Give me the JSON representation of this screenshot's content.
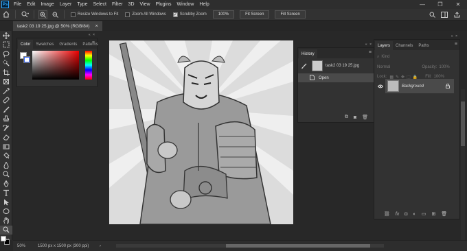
{
  "app": {
    "logo_text": "Ps"
  },
  "menu": [
    "File",
    "Edit",
    "Image",
    "Layer",
    "Type",
    "Select",
    "Filter",
    "3D",
    "View",
    "Plugins",
    "Window",
    "Help"
  ],
  "window_controls": {
    "minimize": "—",
    "restore": "❐",
    "close": "✕"
  },
  "options_bar": {
    "resize_windows_label": "Resize Windows to Fit",
    "zoom_all_label": "Zoom All Windows",
    "scrubby_zoom_label": "Scrubby Zoom",
    "scrubby_zoom_checked": true,
    "zoom_value": "100%",
    "fit_screen_label": "Fit Screen",
    "fill_screen_label": "Fill Screen"
  },
  "document_tab": {
    "title": "task2 03 19 25.jpg @ 50% (RGB/8#)",
    "close": "×"
  },
  "status": {
    "zoom": "50%",
    "doc_size": "1500 px x 1500 px (300 ppi)",
    "arrow": "›"
  },
  "color_panel": {
    "tabs": [
      "Color",
      "Swatches",
      "Gradients",
      "Patterns"
    ],
    "active_tab": "Color",
    "menu": "≡",
    "collapse": "«  ×"
  },
  "history_panel": {
    "tab": "History",
    "snapshot_name": "task2 03 19 25.jpg",
    "steps": [
      "Open"
    ],
    "menu": "≡",
    "collapse": "«  ×"
  },
  "layers_panel": {
    "tabs": [
      "Layers",
      "Channels",
      "Paths"
    ],
    "active_tab": "Layers",
    "filter_placeholder": "Kind",
    "blend_mode": "Normal",
    "opacity_label": "Opacity:",
    "opacity_value": "100%",
    "lock_label": "Lock:",
    "fill_label": "Fill:",
    "fill_value": "100%",
    "layers": [
      {
        "name": "Background",
        "visible": true,
        "locked": true
      }
    ],
    "menu": "≡",
    "collapse": "«  ×"
  },
  "colors": {
    "accent": "#31a8ff",
    "panel_bg": "#323232",
    "canvas_bg": "#282828"
  }
}
